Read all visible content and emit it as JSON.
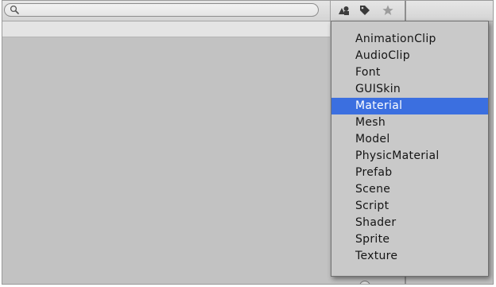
{
  "toolbar": {
    "search": {
      "value": "",
      "placeholder": ""
    },
    "icons": [
      "filter-by-type-icon",
      "filter-by-label-icon",
      "favorites-star-icon"
    ]
  },
  "type_filter_menu": {
    "items": [
      "AnimationClip",
      "AudioClip",
      "Font",
      "GUISkin",
      "Material",
      "Mesh",
      "Model",
      "PhysicMaterial",
      "Prefab",
      "Scene",
      "Script",
      "Shader",
      "Sprite",
      "Texture"
    ],
    "selected": "Material"
  },
  "colors": {
    "selection": "#3b6fe0",
    "menu_background": "#c9c9c9",
    "panel_background": "#c2c2c2"
  }
}
